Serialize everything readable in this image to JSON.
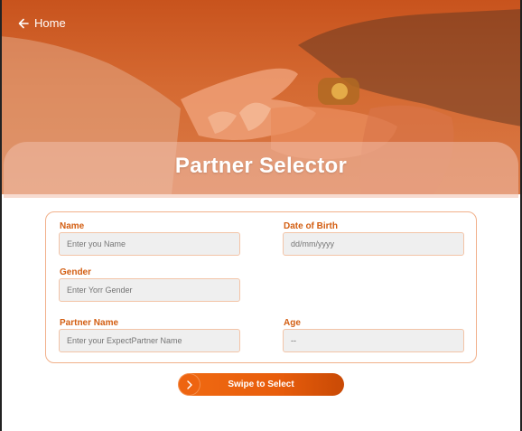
{
  "header": {
    "home_label": "Home",
    "title": "Partner Selector"
  },
  "form": {
    "name": {
      "label": "Name",
      "placeholder": "Enter you Name"
    },
    "dob": {
      "label": "Date of Birth",
      "placeholder": "dd/mm/yyyy"
    },
    "gender": {
      "label": "Gender",
      "placeholder": "Enter Yorr Gender"
    },
    "partner_name": {
      "label": "Partner Name",
      "placeholder": "Enter your ExpectPartner Name"
    },
    "age": {
      "label": "Age",
      "value": "--"
    }
  },
  "action": {
    "swipe_label": "Swipe to Select"
  },
  "colors": {
    "accent": "#e85d0c",
    "label": "#d35e12",
    "hero": "#c8531d"
  }
}
